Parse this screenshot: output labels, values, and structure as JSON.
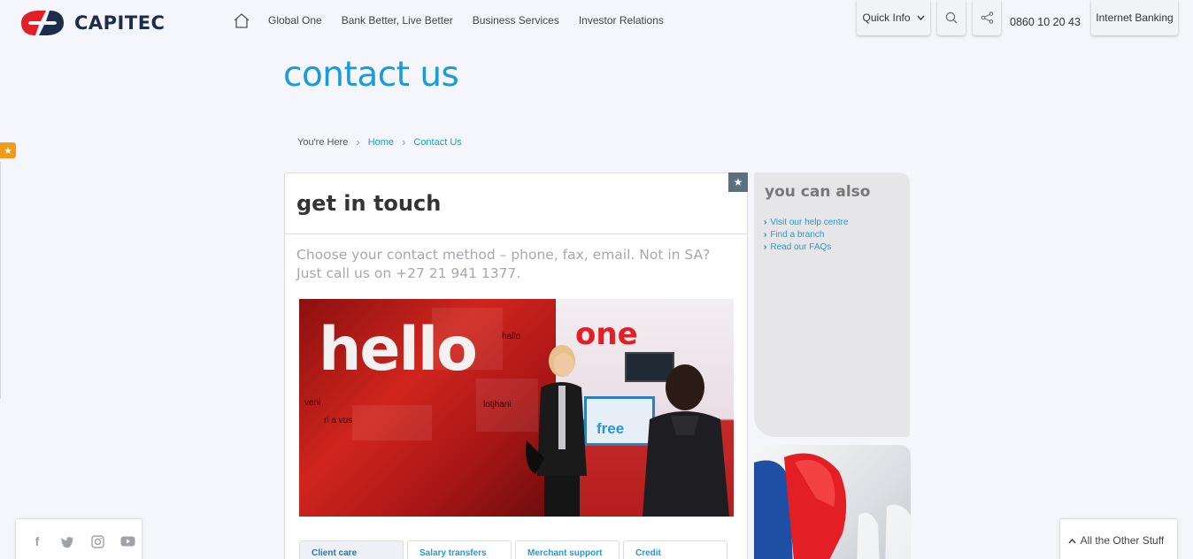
{
  "header": {
    "brand": "CAPITEC",
    "nav": [
      "Global One",
      "Bank Better, Live Better",
      "Business Services",
      "Investor Relations"
    ],
    "quick_info": "Quick Info",
    "phone": "0860 10 20 43",
    "internet_banking": "Internet Banking"
  },
  "page": {
    "title": "contact us"
  },
  "breadcrumb": {
    "label": "You're Here",
    "items": [
      "Home",
      "Contact Us"
    ]
  },
  "main": {
    "title": "get in touch",
    "intro": "Choose your contact method – phone, fax, email. Not in SA? Just call us on +27 21 941 1377.",
    "hero": {
      "hello": "hello",
      "one": "one",
      "free": "free",
      "words": [
        "hallo",
        "veni",
        "ri a vus",
        "lotjhani"
      ]
    },
    "tabs": [
      "Client care",
      "Salary transfers",
      "Merchant support",
      "Credit"
    ]
  },
  "side": {
    "title": "you can also",
    "links": [
      "Visit our help centre",
      "Find a branch",
      "Read our FAQs"
    ]
  },
  "footer": {
    "other": "All the Other Stuff"
  },
  "colors": {
    "accent": "#1b9cd8",
    "brand_red": "#e31e24",
    "brand_navy": "#1c2d4a",
    "star_orange": "#f29b1b"
  }
}
